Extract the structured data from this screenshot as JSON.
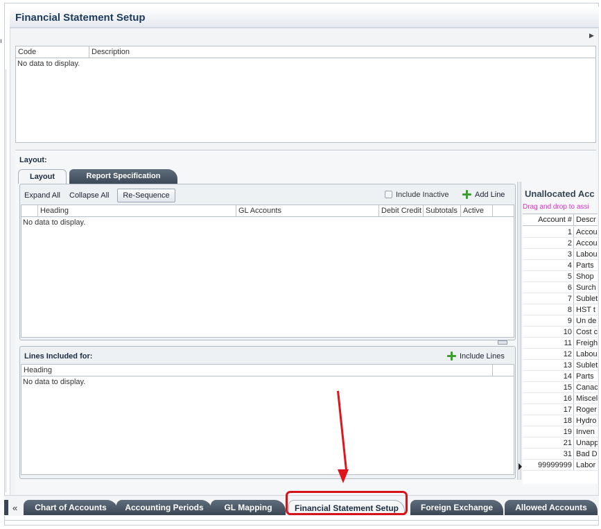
{
  "window": {
    "title": "Financial Statement Setup"
  },
  "codes_table": {
    "columns": [
      "Code",
      "Description"
    ],
    "empty_text": "No data to display."
  },
  "layout": {
    "label": "Layout:",
    "tabs": [
      {
        "label": "Layout",
        "active": true
      },
      {
        "label": "Report Specification",
        "active": false
      }
    ],
    "toolbar": {
      "expand_all": "Expand All",
      "collapse_all": "Collapse All",
      "resequence": "Re-Sequence",
      "include_inactive": "Include Inactive",
      "include_inactive_checked": false,
      "add_line": "Add Line"
    },
    "grid": {
      "columns": [
        "Heading",
        "GL Accounts",
        "Debit Credit",
        "Subtotals",
        "Active"
      ],
      "empty_text": "No data to display."
    }
  },
  "lines_included": {
    "title": "Lines Included for:",
    "include_lines": "Include Lines",
    "columns": [
      "Heading"
    ],
    "empty_text": "No data to display."
  },
  "unallocated": {
    "title": "Unallocated Acc",
    "hint": "Drag and drop to assi",
    "columns": [
      "Account #",
      "Descr"
    ],
    "rows": [
      {
        "num": "1",
        "desc": "Accou"
      },
      {
        "num": "2",
        "desc": "Accou"
      },
      {
        "num": "3",
        "desc": "Labou"
      },
      {
        "num": "4",
        "desc": "Parts"
      },
      {
        "num": "5",
        "desc": "Shop"
      },
      {
        "num": "6",
        "desc": "Surch"
      },
      {
        "num": "7",
        "desc": "Sublet"
      },
      {
        "num": "8",
        "desc": "HST t"
      },
      {
        "num": "9",
        "desc": "Un de"
      },
      {
        "num": "10",
        "desc": "Cost c"
      },
      {
        "num": "11",
        "desc": "Freigh"
      },
      {
        "num": "12",
        "desc": "Labou"
      },
      {
        "num": "13",
        "desc": "Sublet"
      },
      {
        "num": "14",
        "desc": "Parts"
      },
      {
        "num": "15",
        "desc": "Canac"
      },
      {
        "num": "16",
        "desc": "Miscel"
      },
      {
        "num": "17",
        "desc": "Roger"
      },
      {
        "num": "18",
        "desc": "Hydro"
      },
      {
        "num": "19",
        "desc": "Inven"
      },
      {
        "num": "21",
        "desc": "Unapp"
      },
      {
        "num": "31",
        "desc": "Bad D"
      },
      {
        "num": "99999999",
        "desc": "Labor"
      }
    ]
  },
  "bottom_tabs": [
    {
      "label": "Chart of Accounts",
      "active": false
    },
    {
      "label": "Accounting Periods",
      "active": false
    },
    {
      "label": "GL Mapping",
      "active": false
    },
    {
      "label": "Financial Statement Setup",
      "active": true
    },
    {
      "label": "Foreign Exchange",
      "active": false
    },
    {
      "label": "Allowed Accounts",
      "active": false
    }
  ],
  "colors": {
    "annotation": "#e0141c",
    "tab_dark": "#3b4654",
    "hint": "#e02ec8"
  }
}
